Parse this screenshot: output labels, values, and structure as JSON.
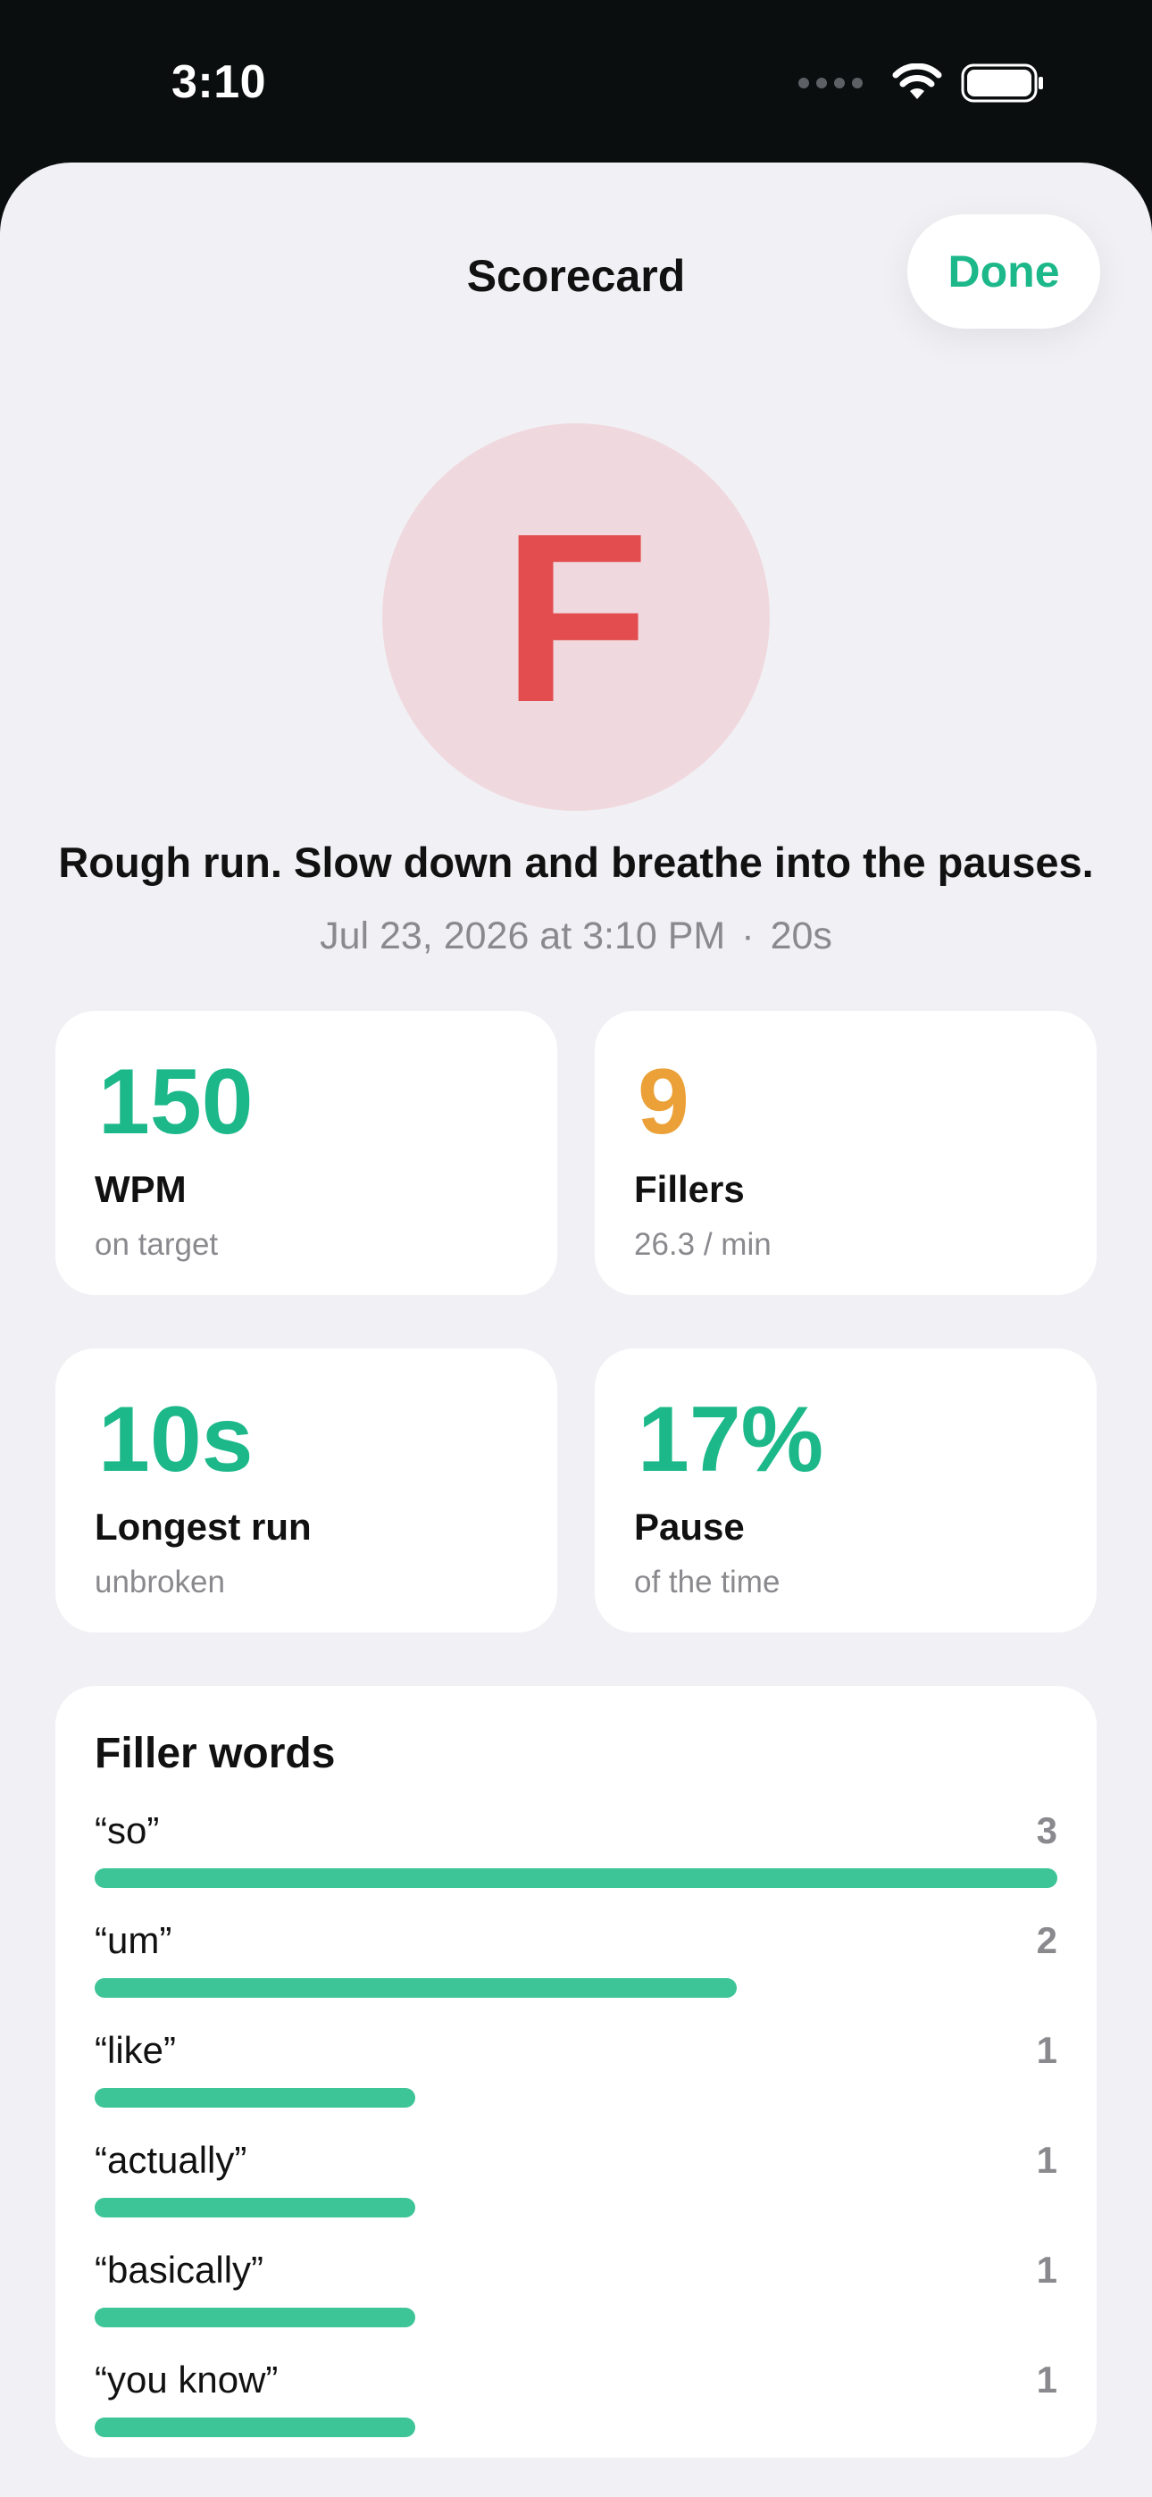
{
  "status_bar": {
    "time": "3:10"
  },
  "header": {
    "title": "Scorecard",
    "done_label": "Done"
  },
  "grade": {
    "letter": "F",
    "color": "#e34d4f",
    "background": "#f0d9de"
  },
  "summary": {
    "headline": "Rough run. Slow down and breathe into the pauses.",
    "date": "Jul 23, 2026 at 3:10 PM",
    "separator": "·",
    "duration": "20s"
  },
  "stats": [
    {
      "value": "150",
      "label": "WPM",
      "sub": "on target",
      "color": "#1cb88a"
    },
    {
      "value": "9",
      "label": "Fillers",
      "sub": "26.3 / min",
      "color": "#eba137"
    },
    {
      "value": "10s",
      "label": "Longest run",
      "sub": "unbroken",
      "color": "#1cb88a"
    },
    {
      "value": "17%",
      "label": "Pause",
      "sub": "of the time",
      "color": "#1cb88a"
    }
  ],
  "filler_words": {
    "title": "Filler words",
    "items": [
      {
        "word": "“so”",
        "count": 3,
        "fraction": 1.0
      },
      {
        "word": "“um”",
        "count": 2,
        "fraction": 0.667
      },
      {
        "word": "“like”",
        "count": 1,
        "fraction": 0.333
      },
      {
        "word": "“actually”",
        "count": 1,
        "fraction": 0.333
      },
      {
        "word": "“basically”",
        "count": 1,
        "fraction": 0.333
      },
      {
        "word": "“you know”",
        "count": 1,
        "fraction": 0.333
      }
    ],
    "bar_color": "#3dc497"
  },
  "colors": {
    "accent": "#1cb88a",
    "warning": "#eba137",
    "danger": "#e34d4f"
  }
}
